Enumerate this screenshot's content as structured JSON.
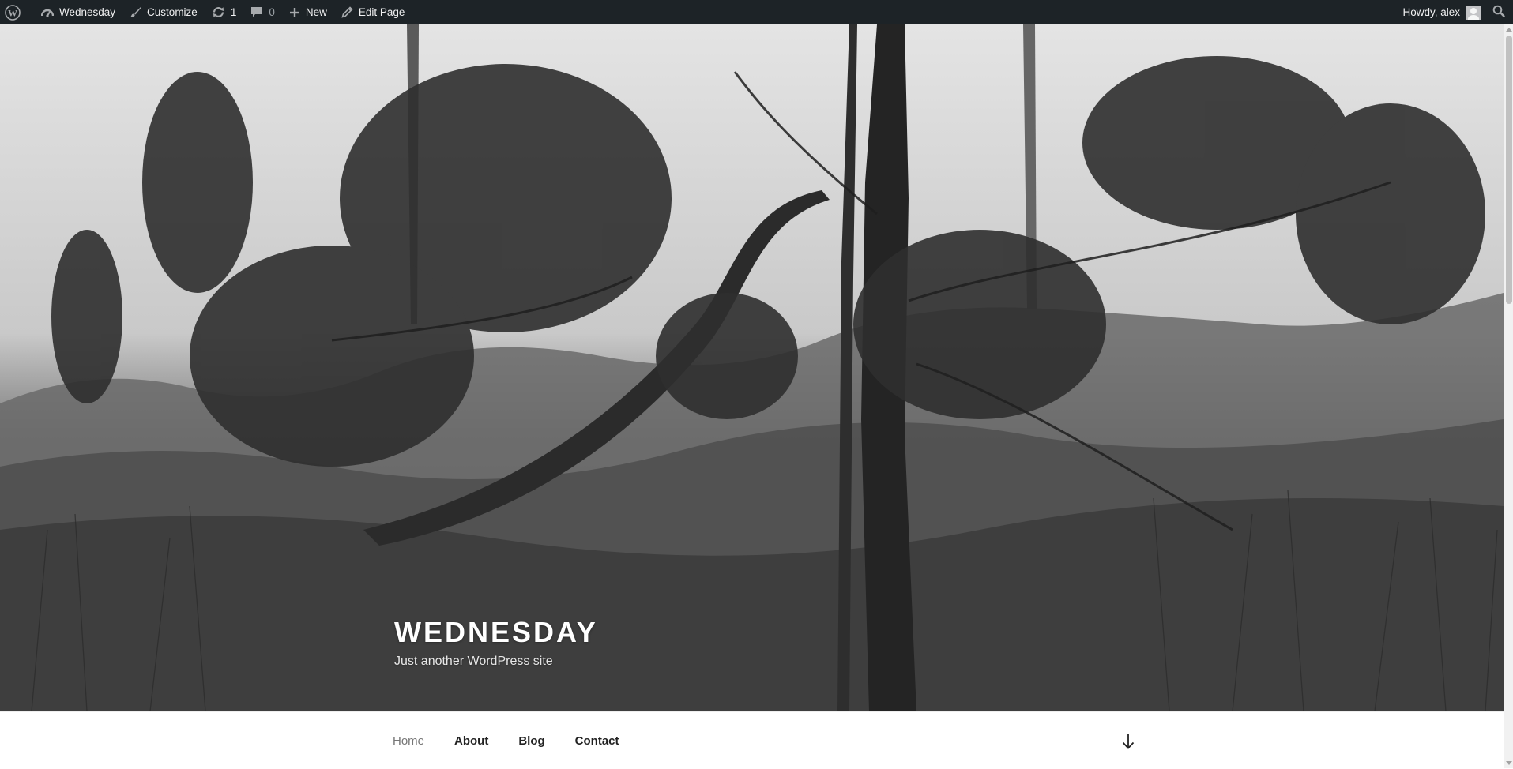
{
  "admin_bar": {
    "site_name": "Wednesday",
    "customize": "Customize",
    "updates_count": "1",
    "comments_count": "0",
    "new": "New",
    "edit_page": "Edit Page",
    "howdy": "Howdy, alex"
  },
  "header": {
    "site_title": "WEDNESDAY",
    "tagline": "Just another WordPress site"
  },
  "nav": {
    "items": [
      {
        "label": "Home",
        "current": true
      },
      {
        "label": "About"
      },
      {
        "label": "Blog"
      },
      {
        "label": "Contact"
      }
    ]
  },
  "icons": {
    "wordpress": "wordpress-logo-icon",
    "dashboard": "dashboard-icon",
    "customize": "brush-icon",
    "updates": "updates-icon",
    "comments": "comment-icon",
    "new": "plus-icon",
    "edit": "pencil-icon",
    "search": "search-icon",
    "scroll": "arrow-down-icon"
  },
  "colors": {
    "admin_bar_bg": "#1d2327",
    "admin_bar_text": "#f0f0f1",
    "nav_text": "#222222",
    "nav_current": "#767676"
  }
}
